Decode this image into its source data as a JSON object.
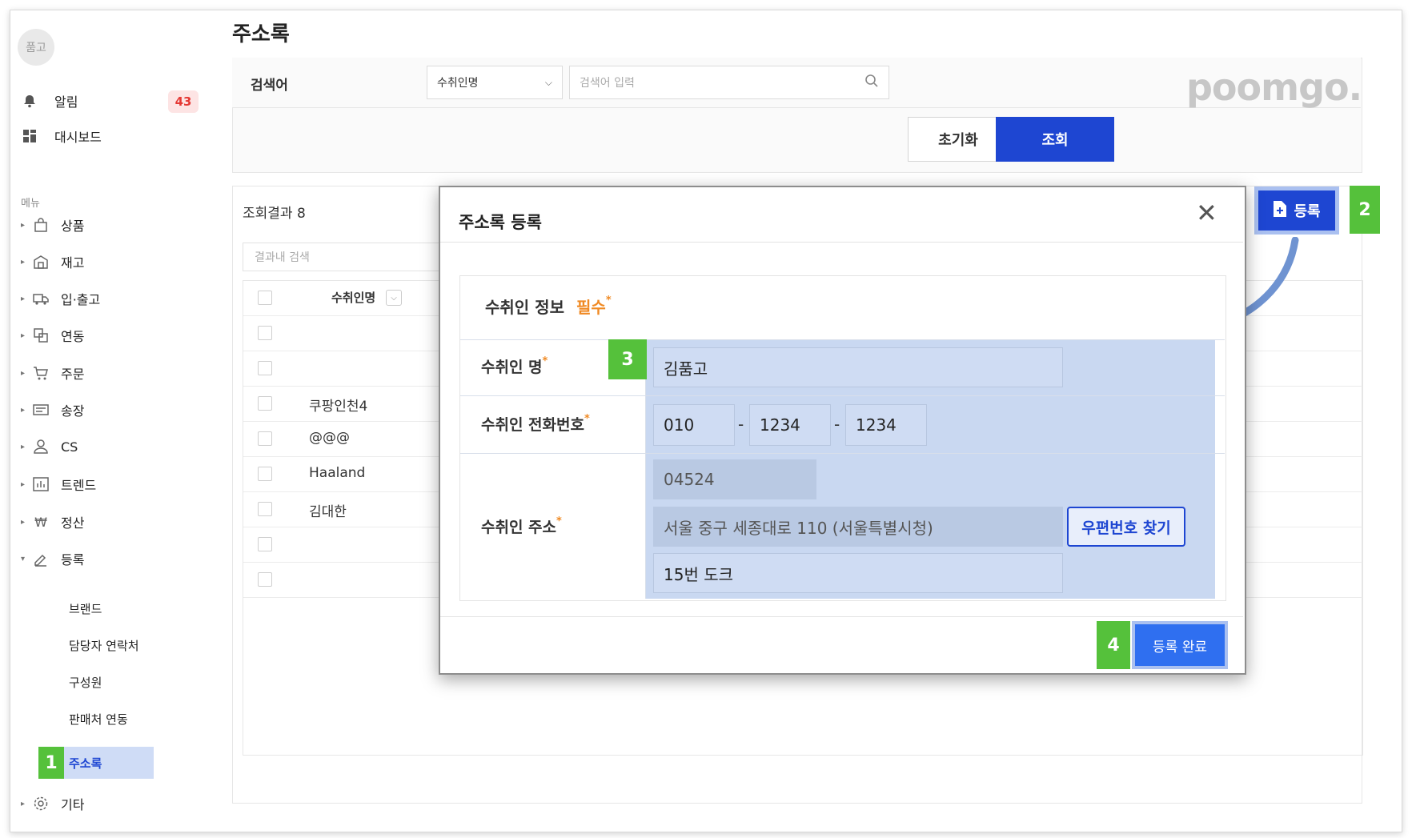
{
  "page_title": "주소록",
  "sidebar": {
    "avatar_text": "품고",
    "notification_label": "알림",
    "notification_count": "43",
    "dashboard_label": "대시보드",
    "menu_header": "메뉴",
    "items": [
      {
        "label": "상품",
        "icon": "bag-icon"
      },
      {
        "label": "재고",
        "icon": "warehouse-icon"
      },
      {
        "label": "입·출고",
        "icon": "truck-icon"
      },
      {
        "label": "연동",
        "icon": "link-icon"
      },
      {
        "label": "주문",
        "icon": "cart-icon"
      },
      {
        "label": "송장",
        "icon": "invoice-icon"
      },
      {
        "label": "CS",
        "icon": "person-icon"
      },
      {
        "label": "트렌드",
        "icon": "chart-icon"
      },
      {
        "label": "정산",
        "icon": "won-icon"
      },
      {
        "label": "등록",
        "icon": "pen-icon"
      }
    ],
    "register_sub_items": [
      "브랜드",
      "담당자 연락처",
      "구성원",
      "판매처 연동",
      "주소록"
    ],
    "other_label": "기타"
  },
  "search": {
    "label": "검색어",
    "select_value": "수취인명",
    "input_placeholder": "검색어 입력",
    "reset_label": "초기화",
    "submit_label": "조회"
  },
  "logo_text": "poomgo.",
  "results": {
    "label": "조회결과 8",
    "filter_placeholder": "결과내 검색",
    "column_header": "수취인명",
    "rows": [
      "",
      "",
      "쿠팡인천4",
      "@@@",
      "Haaland",
      "김대한",
      "",
      ""
    ]
  },
  "register_button_label": "등록",
  "modal": {
    "title": "주소록 등록",
    "section_label": "수취인 정보",
    "required_label": "필수",
    "name_label": "수취인 명",
    "name_value": "김품고",
    "phone_label": "수취인 전화번호",
    "phone_parts": [
      "010",
      "1234",
      "1234"
    ],
    "address_label": "수취인 주소",
    "zipcode": "04524",
    "address": "서울 중구 세종대로 110 (서울특별시청)",
    "address_detail": "15번 도크",
    "zip_search_label": "우편번호 찾기",
    "submit_label": "등록 완료"
  },
  "step_markers": [
    "1",
    "2",
    "3",
    "4"
  ],
  "colors": {
    "primary": "#1e46d2",
    "step_green": "#55c13b",
    "highlight": "#c9d8f1",
    "required": "#f08a24"
  }
}
